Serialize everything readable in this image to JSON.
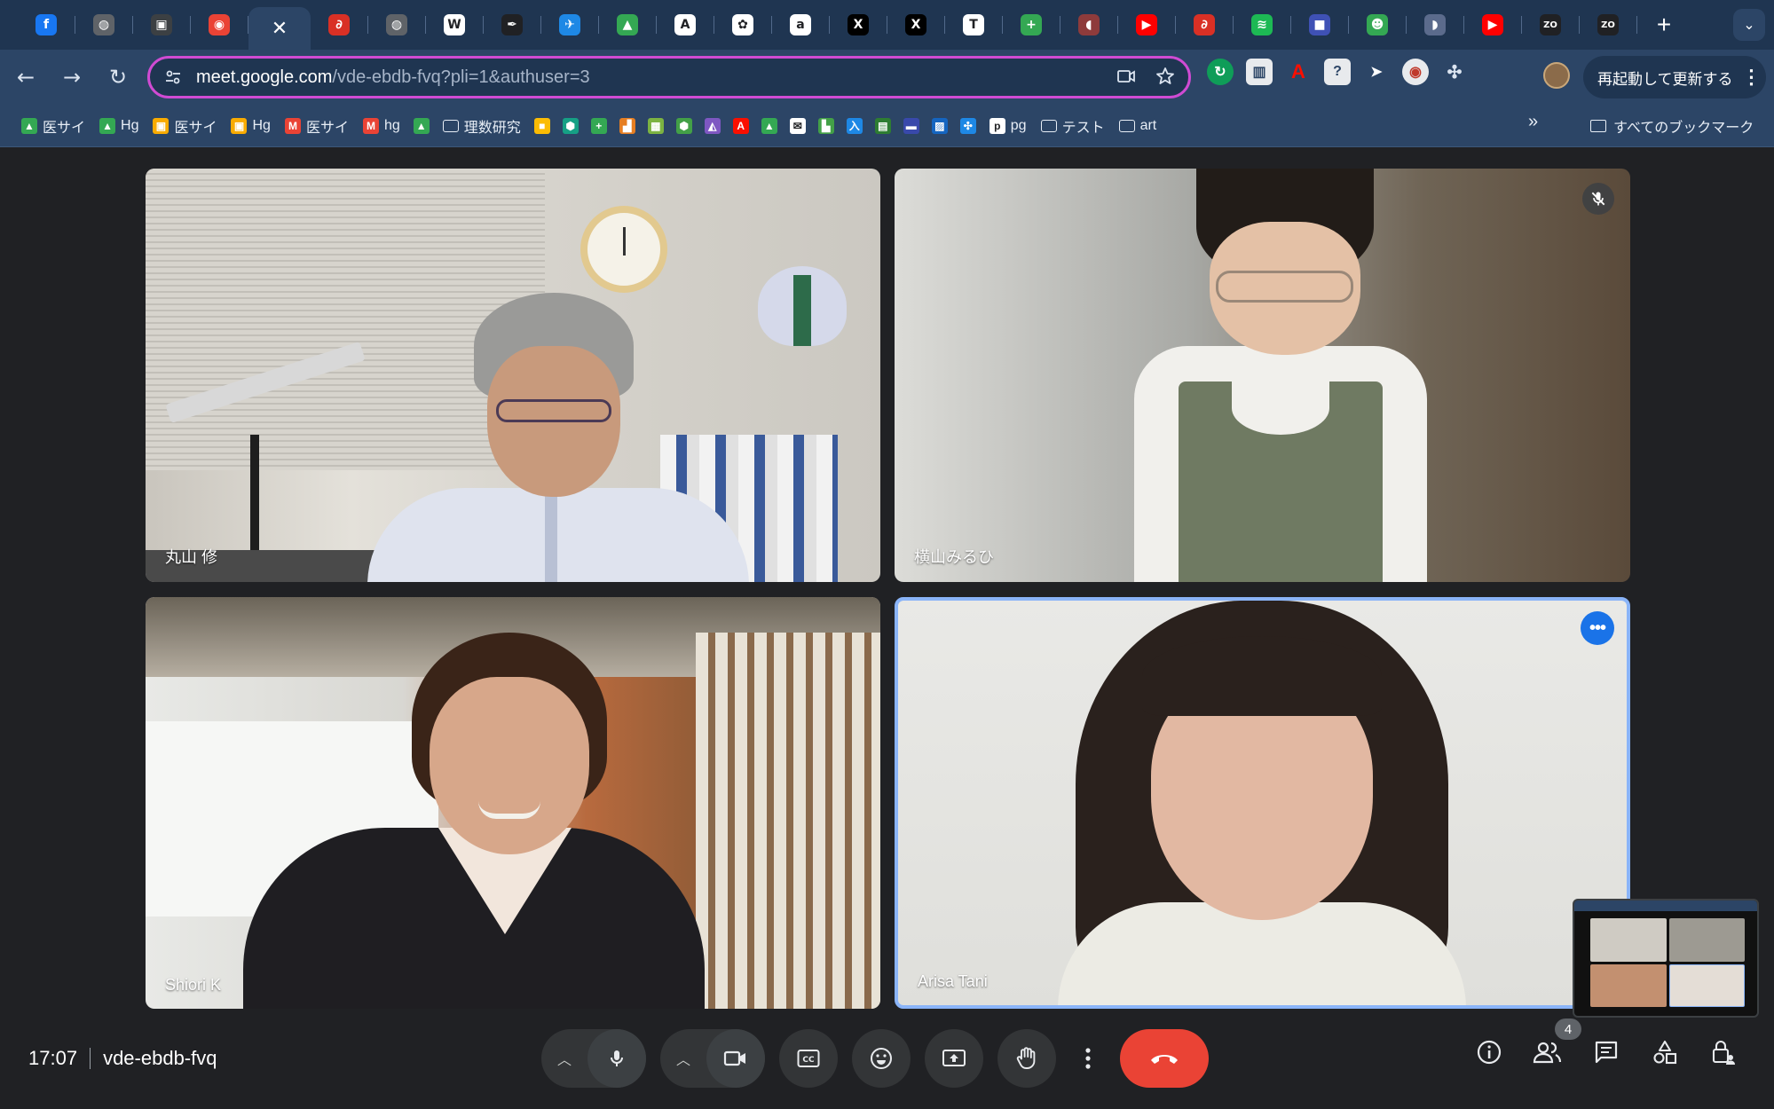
{
  "browser": {
    "url_host": "meet.google.com",
    "url_path": "/vde-ebdb-fvq?pli=1&authuser=3",
    "relaunch_label": "再起動して更新する",
    "tabs": [
      {
        "icon": "facebook-icon",
        "color": "#1877f2",
        "glyph": "f"
      },
      {
        "icon": "globe-icon",
        "color": "#5f6368",
        "glyph": "◍"
      },
      {
        "icon": "site-icon",
        "color": "#3c4043",
        "glyph": "▣"
      },
      {
        "icon": "meet-notif-icon",
        "color": "#ea4335",
        "glyph": "◉"
      },
      {
        "icon": "meet-active-tab",
        "color": "#2c4566",
        "glyph": "✕",
        "active": true
      },
      {
        "icon": "swirl-icon",
        "color": "#d93025",
        "glyph": "∂"
      },
      {
        "icon": "globe-icon",
        "color": "#5f6368",
        "glyph": "◍"
      },
      {
        "icon": "wikipedia-icon",
        "color": "#ffffff",
        "glyph": "W"
      },
      {
        "icon": "scribble-icon",
        "color": "#202124",
        "glyph": "✒"
      },
      {
        "icon": "airline-icon",
        "color": "#1e88e5",
        "glyph": "✈"
      },
      {
        "icon": "google-drive-icon",
        "color": "#34a853",
        "glyph": "▲"
      },
      {
        "icon": "anthropic-icon",
        "color": "#ffffff",
        "glyph": "A"
      },
      {
        "icon": "openai-icon",
        "color": "#ffffff",
        "glyph": "✿"
      },
      {
        "icon": "amazon-icon",
        "color": "#ffffff",
        "glyph": "a"
      },
      {
        "icon": "x-icon",
        "color": "#000000",
        "glyph": "X"
      },
      {
        "icon": "x-icon",
        "color": "#000000",
        "glyph": "X"
      },
      {
        "icon": "nikkei-icon",
        "color": "#ffffff",
        "glyph": "T"
      },
      {
        "icon": "sheets-plus-icon",
        "color": "#34a853",
        "glyph": "+"
      },
      {
        "icon": "pill-icon",
        "color": "#8e3b3b",
        "glyph": "◖"
      },
      {
        "icon": "youtube-icon",
        "color": "#ff0000",
        "glyph": "▶"
      },
      {
        "icon": "swirl-icon",
        "color": "#d93025",
        "glyph": "∂"
      },
      {
        "icon": "spotify-icon",
        "color": "#1db954",
        "glyph": "≋"
      },
      {
        "icon": "blue-square-icon",
        "color": "#3f51b5",
        "glyph": "■"
      },
      {
        "icon": "green-app-icon",
        "color": "#34a853",
        "glyph": "☻"
      },
      {
        "icon": "shape-icon",
        "color": "#5b6b8c",
        "glyph": "◗"
      },
      {
        "icon": "youtube-icon",
        "color": "#ff0000",
        "glyph": "▶"
      },
      {
        "icon": "zo-icon",
        "color": "#202124",
        "glyph": "ZO"
      },
      {
        "icon": "zo-icon",
        "color": "#202124",
        "glyph": "ZO"
      }
    ],
    "bookmarks": [
      {
        "icon": "google-drive-icon",
        "color": "#34a853",
        "glyph": "▲",
        "label": "医サイ"
      },
      {
        "icon": "google-drive-icon",
        "color": "#34a853",
        "glyph": "▲",
        "label": "Hg"
      },
      {
        "icon": "classroom-icon",
        "color": "#f9ab00",
        "glyph": "▣",
        "label": "医サイ"
      },
      {
        "icon": "classroom-icon",
        "color": "#f9ab00",
        "glyph": "▣",
        "label": "Hg"
      },
      {
        "icon": "gmail-icon",
        "color": "#ea4335",
        "glyph": "M",
        "label": "医サイ"
      },
      {
        "icon": "gmail-icon",
        "color": "#ea4335",
        "glyph": "M",
        "label": "hg"
      },
      {
        "icon": "google-drive-icon",
        "color": "#34a853",
        "glyph": "▲",
        "label": ""
      },
      {
        "icon": "folder-icon",
        "color": "#2c4566",
        "glyph": "▭",
        "label": "理数研究"
      },
      {
        "icon": "keep-icon",
        "color": "#fbbc04",
        "glyph": "■",
        "label": ""
      },
      {
        "icon": "hex-icon",
        "color": "#16a085",
        "glyph": "⬢",
        "label": ""
      },
      {
        "icon": "sheets-plus-icon",
        "color": "#34a853",
        "glyph": "+",
        "label": ""
      },
      {
        "icon": "chart-icon",
        "color": "#e67e22",
        "glyph": "▟",
        "label": ""
      },
      {
        "icon": "map-icon",
        "color": "#7cb342",
        "glyph": "▦",
        "label": ""
      },
      {
        "icon": "hex-icon",
        "color": "#43a047",
        "glyph": "⬢",
        "label": ""
      },
      {
        "icon": "triangle-icon",
        "color": "#7e57c2",
        "glyph": "◭",
        "label": ""
      },
      {
        "icon": "adobe-icon",
        "color": "#fa0f00",
        "glyph": "A",
        "label": ""
      },
      {
        "icon": "google-drive-icon",
        "color": "#34a853",
        "glyph": "▲",
        "label": ""
      },
      {
        "icon": "mail-icon",
        "color": "#ffffff",
        "glyph": "✉",
        "label": ""
      },
      {
        "icon": "chart-icon",
        "color": "#43a047",
        "glyph": "▙",
        "label": ""
      },
      {
        "icon": "japanese-icon",
        "color": "#1e88e5",
        "glyph": "入",
        "label": ""
      },
      {
        "icon": "green-grid-icon",
        "color": "#2e7d32",
        "glyph": "▤",
        "label": ""
      },
      {
        "icon": "form-icon",
        "color": "#3949ab",
        "glyph": "▬",
        "label": ""
      },
      {
        "icon": "card-icon",
        "color": "#1565c0",
        "glyph": "▨",
        "label": ""
      },
      {
        "icon": "puzzle-icon",
        "color": "#1e88e5",
        "glyph": "✣",
        "label": ""
      },
      {
        "icon": "p-icon",
        "color": "#ffffff",
        "glyph": "p",
        "label": "pg"
      },
      {
        "icon": "folder-icon",
        "color": "#2c4566",
        "glyph": "▭",
        "label": "テスト"
      },
      {
        "icon": "folder-icon",
        "color": "#2c4566",
        "glyph": "▭",
        "label": "art"
      }
    ],
    "all_bookmarks_label": "すべてのブックマーク"
  },
  "meet": {
    "time": "17:07",
    "meeting_code": "vde-ebdb-fvq",
    "participant_count": "4",
    "accent_color": "#8ab4f8",
    "end_call_color": "#ea4335",
    "participants": [
      {
        "name": "丸山 修",
        "muted": false
      },
      {
        "name": "横山みるひ",
        "muted": true
      },
      {
        "name": "Shiori K",
        "muted": false
      },
      {
        "name": "Arisa Tani",
        "muted": false,
        "active_speaker": true
      }
    ]
  }
}
